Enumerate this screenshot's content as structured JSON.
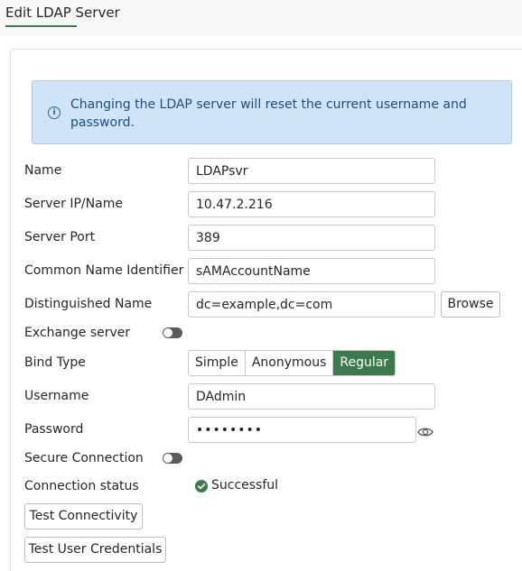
{
  "page": {
    "title": "Edit LDAP Server"
  },
  "info": {
    "message": "Changing the LDAP server will reset the current username and password."
  },
  "form": {
    "name": {
      "label": "Name",
      "value": "LDAPsvr"
    },
    "server_ip": {
      "label": "Server IP/Name",
      "value": "10.47.2.216"
    },
    "server_port": {
      "label": "Server Port",
      "value": "389"
    },
    "cn_identifier": {
      "label": "Common Name Identifier",
      "value": "sAMAccountName"
    },
    "distinguished_name": {
      "label": "Distinguished Name",
      "value": "dc=example,dc=com",
      "browse_label": "Browse"
    },
    "exchange_server": {
      "label": "Exchange server",
      "enabled": false
    },
    "bind_type": {
      "label": "Bind Type",
      "options": [
        "Simple",
        "Anonymous",
        "Regular"
      ],
      "selected": "Regular"
    },
    "username": {
      "label": "Username",
      "value": "DAdmin"
    },
    "password": {
      "label": "Password",
      "value": "••••••••"
    },
    "secure_connection": {
      "label": "Secure Connection",
      "enabled": false
    },
    "connection_status": {
      "label": "Connection status",
      "value": "Successful"
    }
  },
  "actions": {
    "test_connectivity": "Test Connectivity",
    "test_user_credentials": "Test User Credentials"
  },
  "colors": {
    "accent": "#3b7a4a",
    "info_bg": "#cfe4f7",
    "info_text": "#1f4e79",
    "toggle_off": "#5a5a5a"
  }
}
